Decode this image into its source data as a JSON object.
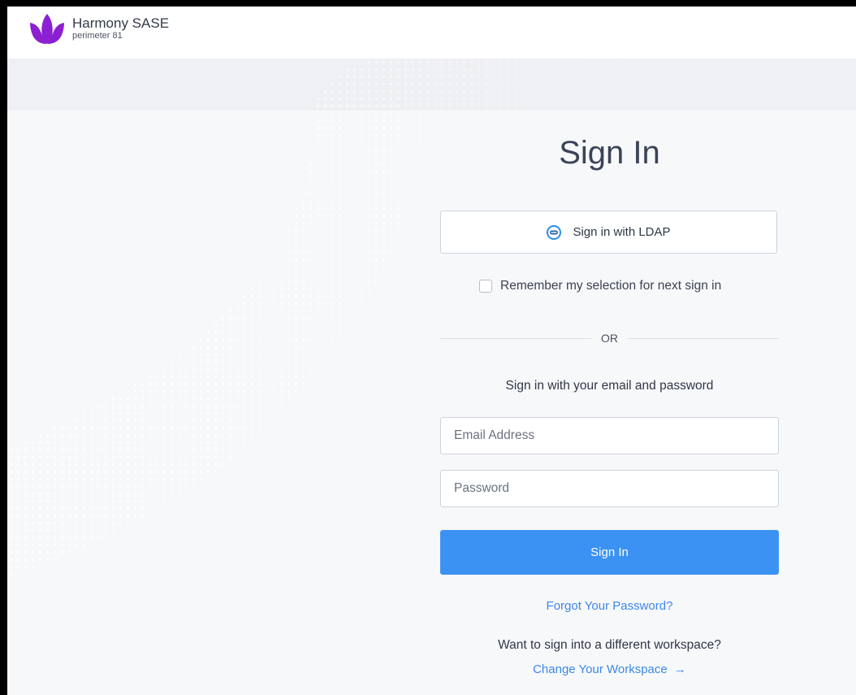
{
  "brand": {
    "title": "Harmony SASE",
    "subtitle": "perimeter 81",
    "logo_icon": "lotus-logo-icon",
    "logo_color": "#8b1fd1"
  },
  "signin": {
    "title": "Sign In",
    "ldap_button_label": "Sign in with LDAP",
    "ldap_icon": "ldap-icon",
    "remember_label": "Remember my selection for next sign in",
    "remember_checked": false,
    "divider_text": "OR",
    "subtitle": "Sign in with your email and password",
    "email": {
      "placeholder": "Email Address",
      "value": ""
    },
    "password": {
      "placeholder": "Password",
      "value": ""
    },
    "submit_label": "Sign In",
    "forgot_label": "Forgot Your Password?",
    "workspace_question": "Want to sign into a different workspace?",
    "change_workspace_label": "Change Your Workspace",
    "change_workspace_icon": "arrow-right-icon"
  },
  "colors": {
    "accent": "#3c92f3",
    "link": "#3c88e8",
    "text": "#2f3747"
  }
}
